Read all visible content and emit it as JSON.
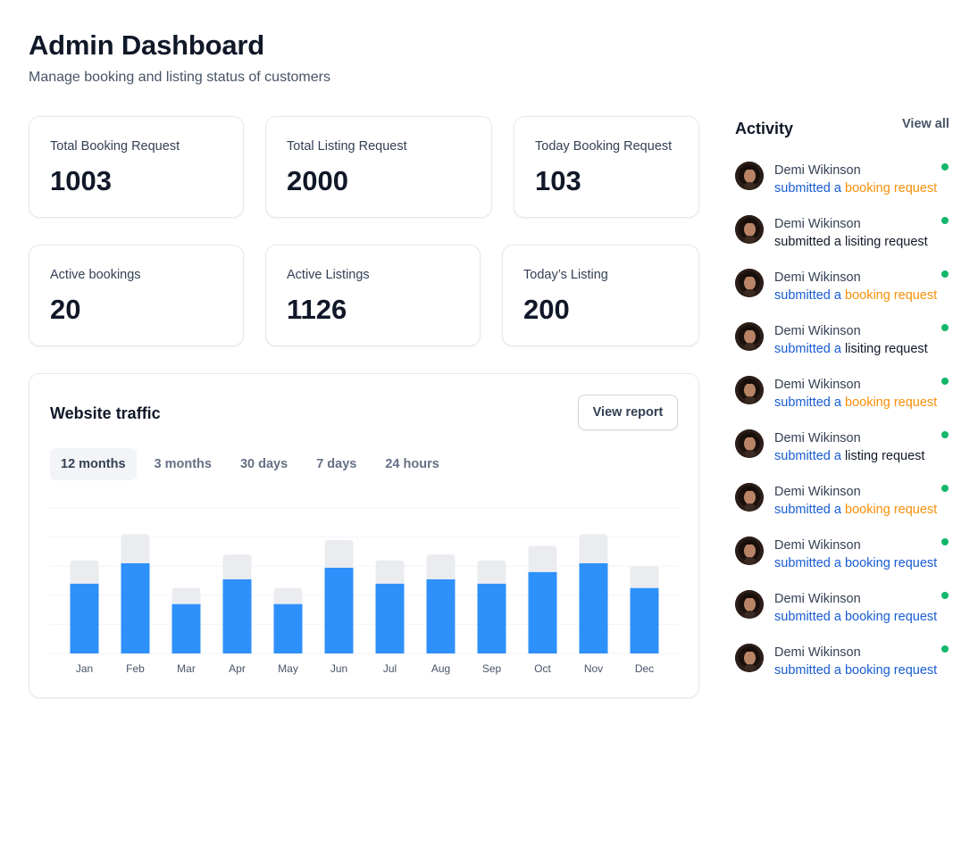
{
  "header": {
    "title": "Admin Dashboard",
    "subtitle": "Manage booking and listing status of customers"
  },
  "stats": [
    {
      "label": "Total Booking Request",
      "value": "1003"
    },
    {
      "label": "Total Listing Request",
      "value": "2000"
    },
    {
      "label": "Today Booking Request",
      "value": "103"
    },
    {
      "label": "Active bookings",
      "value": "20"
    },
    {
      "label": "Active Listings",
      "value": "1126"
    },
    {
      "label": "Today’s Listing",
      "value": "200"
    }
  ],
  "traffic": {
    "title": "Website traffic",
    "view_report_label": "View report",
    "tabs": [
      "12 months",
      "3 months",
      "30 days",
      "7 days",
      "24 hours"
    ],
    "active_tab": "12 months"
  },
  "chart_data": {
    "type": "bar",
    "stacked": true,
    "categories": [
      "Jan",
      "Feb",
      "Mar",
      "Apr",
      "May",
      "Jun",
      "Jul",
      "Aug",
      "Sep",
      "Oct",
      "Nov",
      "Dec"
    ],
    "series": [
      {
        "color": "#2e90fa",
        "values": [
          48,
          62,
          34,
          51,
          34,
          59,
          48,
          51,
          48,
          56,
          62,
          45
        ]
      },
      {
        "color": "#eaecf0",
        "values": [
          16,
          20,
          11,
          17,
          11,
          19,
          16,
          17,
          16,
          18,
          20,
          15
        ]
      }
    ],
    "ylim": [
      0,
      100
    ],
    "grid": true,
    "y_ticks_visible": false
  },
  "activity": {
    "title": "Activity",
    "view_all_label": "View all",
    "online_color": "#12b76a",
    "items": [
      {
        "name": "Demi Wikinson",
        "parts": [
          {
            "text": "submitted a ",
            "style": "blue"
          },
          {
            "text": "booking request",
            "style": "orange"
          }
        ]
      },
      {
        "name": "Demi Wikinson",
        "parts": [
          {
            "text": "submitted a lisiting request",
            "style": "dark"
          }
        ]
      },
      {
        "name": "Demi Wikinson",
        "parts": [
          {
            "text": "submitted a ",
            "style": "blue"
          },
          {
            "text": "booking request",
            "style": "orange"
          }
        ]
      },
      {
        "name": "Demi Wikinson",
        "parts": [
          {
            "text": "submitted a ",
            "style": "blue"
          },
          {
            "text": "lisiting request",
            "style": "dark"
          }
        ]
      },
      {
        "name": "Demi Wikinson",
        "parts": [
          {
            "text": "submitted a ",
            "style": "blue"
          },
          {
            "text": "booking request",
            "style": "orange"
          }
        ]
      },
      {
        "name": "Demi Wikinson",
        "parts": [
          {
            "text": "submitted a ",
            "style": "blue"
          },
          {
            "text": "listing request",
            "style": "dark"
          }
        ]
      },
      {
        "name": "Demi Wikinson",
        "parts": [
          {
            "text": "submitted a ",
            "style": "blue"
          },
          {
            "text": "booking request",
            "style": "orange"
          }
        ]
      },
      {
        "name": "Demi Wikinson",
        "parts": [
          {
            "text": "submitted a booking request",
            "style": "blue"
          }
        ]
      },
      {
        "name": "Demi Wikinson",
        "parts": [
          {
            "text": "submitted a booking request",
            "style": "blue"
          }
        ]
      },
      {
        "name": "Demi Wikinson",
        "parts": [
          {
            "text": "submitted a booking request",
            "style": "blue"
          }
        ]
      }
    ]
  }
}
